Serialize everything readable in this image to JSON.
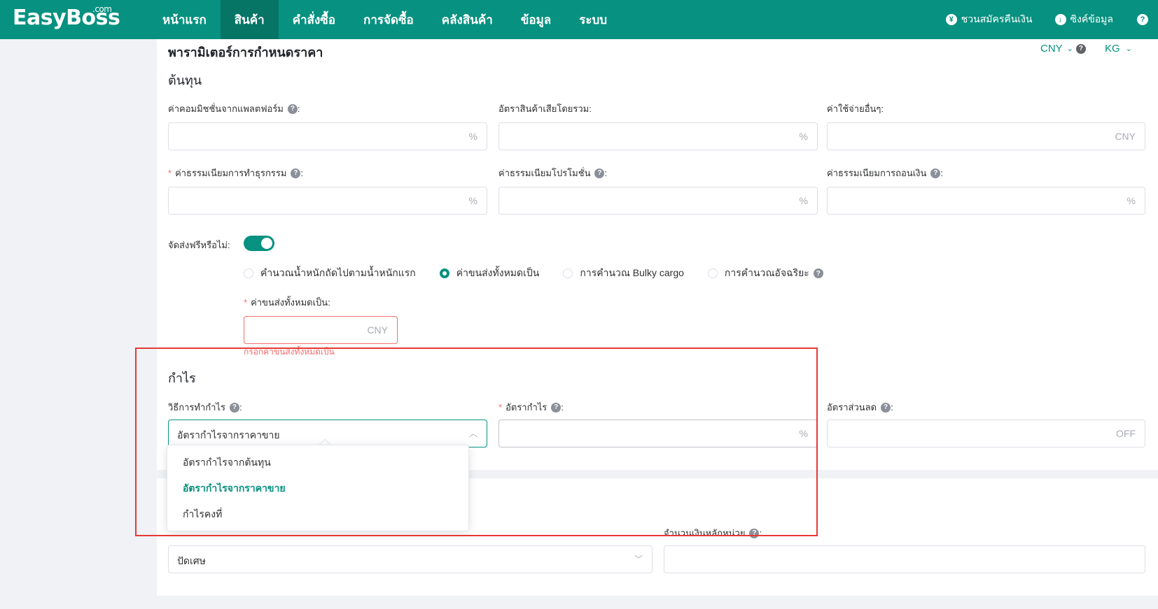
{
  "brand": {
    "name": "EasyBoss",
    "suffix": ".com"
  },
  "nav": {
    "items": [
      {
        "label": "หน้าแรก"
      },
      {
        "label": "สินค้า"
      },
      {
        "label": "คำสั่งซื้อ"
      },
      {
        "label": "การจัดซื้อ"
      },
      {
        "label": "คลังสินค้า"
      },
      {
        "label": "ข้อมูล"
      },
      {
        "label": "ระบบ"
      }
    ],
    "active": "สินค้า"
  },
  "top_right": {
    "refund_label": "ชวนสมัครคืนเงิน",
    "sync_label": "ซิงค์ข้อมูล",
    "help_glyph": "?"
  },
  "page": {
    "title": "พารามิเตอร์การกำหนดราคา",
    "currency": "CNY",
    "weight_unit": "KG"
  },
  "cost": {
    "title": "ต้นทุน",
    "platform_commission": {
      "label": "ค่าคอมมิชชั่นจากแพลตฟอร์ม",
      "value": "",
      "suffix": "%"
    },
    "damage_rate": {
      "label": "อัตราสินค้าเสียโดยรวม:",
      "value": "",
      "suffix": "%"
    },
    "other_expenses": {
      "label": "ค่าใช้จ่ายอื่นๆ:",
      "value": "",
      "suffix": "CNY"
    },
    "transaction_fee": {
      "label": "ค่าธรรมเนียมการทำธุรกรรม",
      "value": "",
      "suffix": "%"
    },
    "promotion_fee": {
      "label": "ค่าธรรมเนียมโปรโมชั่น",
      "value": "",
      "suffix": "%"
    },
    "withdraw_fee": {
      "label": "ค่าธรรมเนียมการถอนเงิน",
      "value": "",
      "suffix": "%"
    }
  },
  "shipping": {
    "free_label": "จัดส่งฟรีหรือไม่:",
    "free_enabled": true,
    "options": [
      {
        "label": "คำนวณน้ำหนักถัดไปตามน้ำหนักแรก",
        "checked": false
      },
      {
        "label": "ค่าขนส่งทั้งหมดเป็น",
        "checked": true
      },
      {
        "label": "การคำนวณ Bulky cargo",
        "checked": false
      },
      {
        "label": "การคำนวณอัจฉริยะ",
        "checked": false
      }
    ],
    "total_label": "ค่าขนส่งทั้งหมดเป็น:",
    "total_value": "",
    "total_suffix": "CNY",
    "total_error": "กรอกค่าขนส่งทั้งหมดเป็น"
  },
  "profit": {
    "title": "กำไร",
    "method_label": "วิธีการทำกำไร",
    "method_value": "อัตรากำไรจากราคาขาย",
    "rate_label": "อัตรากำไร",
    "rate_value": "",
    "rate_suffix": "%",
    "discount_label": "อัตราส่วนลด",
    "discount_value": "",
    "discount_suffix": "OFF",
    "dropdown": [
      {
        "label": "อัตรากำไรจากต้นทุน",
        "selected": false
      },
      {
        "label": "อัตรากำไรจากราคาขาย",
        "selected": true
      },
      {
        "label": "กำไรคงที่",
        "selected": false
      }
    ]
  },
  "rounding": {
    "select_value": "ปัดเศษ",
    "unit_label": "จำนวนเงินหลักหน่วย",
    "unit_value": ""
  },
  "colors": {
    "brand": "#079180",
    "error": "#f56c6c",
    "highlight": "#e53935"
  }
}
